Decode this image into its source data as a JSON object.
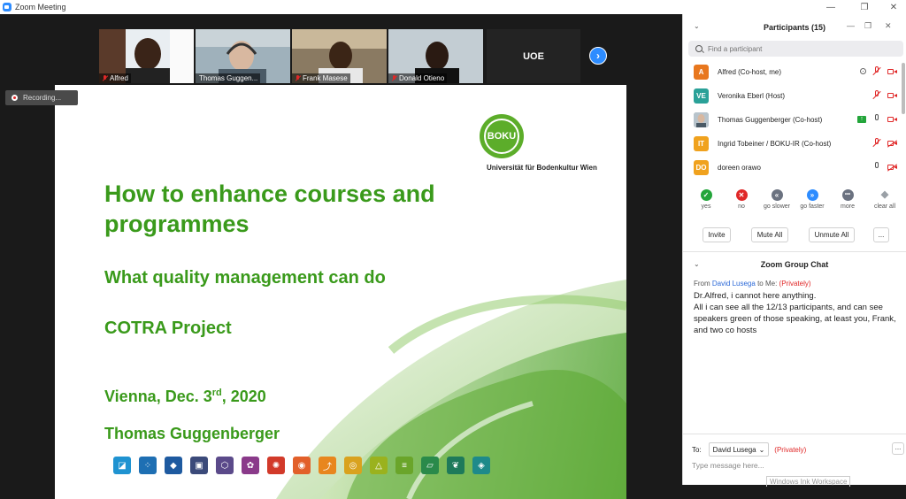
{
  "window": {
    "title": "Zoom Meeting",
    "controls": [
      "—",
      "❐",
      "✕"
    ]
  },
  "video_strip": {
    "tiles": [
      {
        "name": "Alfred",
        "muted": true,
        "bg": "#cfd6dc"
      },
      {
        "name": "Thomas Guggen...",
        "muted": false,
        "bg": "#7a8f9a"
      },
      {
        "name": "Frank Masese",
        "muted": true,
        "bg": "#7a6b55"
      },
      {
        "name": "Donald Otieno",
        "muted": true,
        "bg": "#a8b6bf"
      }
    ],
    "label_tile": "UOE",
    "next_glyph": "›"
  },
  "recording_label": "Recording...",
  "slide": {
    "logo_text": "BOKU",
    "university": "Universität für Bodenkultur Wien",
    "title_line1": "How to enhance courses and",
    "title_line2": "programmes",
    "subtitle": "What quality management can do",
    "project": "COTRA Project",
    "date_prefix": "Vienna, Dec. 3",
    "date_sup": "rd",
    "date_suffix": ", 2020",
    "author": "Thomas Guggenberger",
    "icon_colors": [
      "#1f93d1",
      "#1e6fb3",
      "#1e5aa0",
      "#3b4a7a",
      "#5b4a8a",
      "#8a3a8a",
      "#d23a2a",
      "#e2602a",
      "#e8861e",
      "#d9a21e",
      "#9ab21e",
      "#6aa52a",
      "#2a8a4a",
      "#1e7a5a",
      "#1e8a8a"
    ]
  },
  "participants": {
    "title": "Participants (15)",
    "search_placeholder": "Find a participant",
    "rows": [
      {
        "initials": "A",
        "color": "#e8771e",
        "name": "Alfred (Co-host, me)"
      },
      {
        "initials": "VE",
        "color": "#2aa198",
        "name": "Veronika Eberl (Host)"
      },
      {
        "initials": "",
        "color": "#8a9aa8",
        "name": "Thomas Guggenberger (Co-host)"
      },
      {
        "initials": "IT",
        "color": "#f0a21e",
        "name": "Ingrid Tobeiner / BOKU-IR (Co-host)"
      },
      {
        "initials": "DO",
        "color": "#f0a21e",
        "name": "doreen orawo"
      }
    ],
    "reactions": [
      {
        "label": "yes",
        "glyph": "✓",
        "color": "#23a53a"
      },
      {
        "label": "no",
        "glyph": "✕",
        "color": "#e02828"
      },
      {
        "label": "go slower",
        "glyph": "«",
        "color": "#6b7280"
      },
      {
        "label": "go faster",
        "glyph": "»",
        "color": "#2d8cff"
      },
      {
        "label": "more",
        "glyph": "•••",
        "color": "#6b7280"
      },
      {
        "label": "clear all",
        "glyph": "◆",
        "color": "#9aa0a6"
      }
    ],
    "buttons": {
      "invite": "Invite",
      "mute_all": "Mute All",
      "unmute_all": "Unmute All",
      "more": "..."
    }
  },
  "chat": {
    "title": "Zoom Group Chat",
    "from_prefix": "From",
    "from_name": "David Lusega",
    "from_mid": "to Me:",
    "from_privacy": "(Privately)",
    "message": "Dr.Alfred, i cannot here anything.\nAll i can see all the 12/13 participants, and can see speakers green of those speaking, at least you, Frank, and two co hosts",
    "to_label": "To:",
    "to_value": "David Lusega",
    "to_privacy": "(Privately)",
    "more": "...",
    "input_placeholder": "Type message here...",
    "watermark": "Windows Ink Workspace"
  }
}
